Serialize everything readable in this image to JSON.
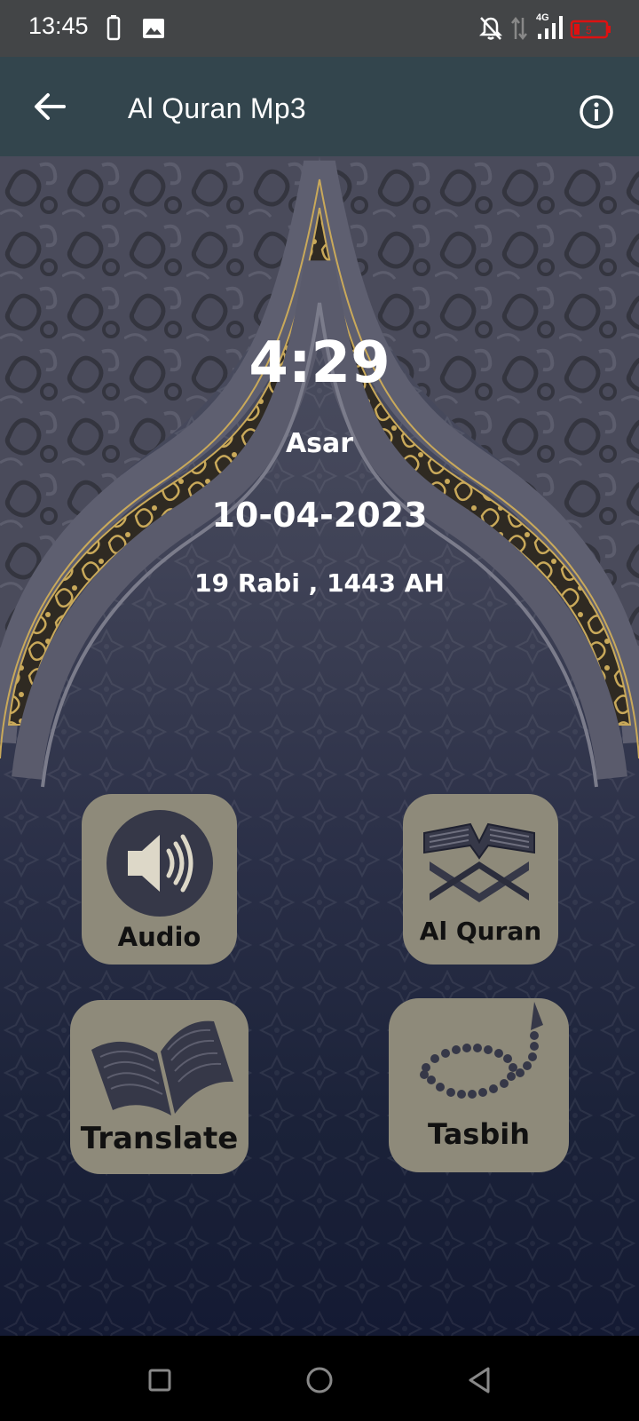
{
  "status_bar": {
    "time": "13:45",
    "network": "4G",
    "icons": [
      "battery-small-icon",
      "image-icon",
      "notification-off-icon",
      "data-arrows-icon",
      "signal-icon",
      "battery-icon"
    ]
  },
  "app_bar": {
    "title": "Al Quran Mp3",
    "back_icon": "arrow-left-icon",
    "info_icon": "info-icon"
  },
  "prayer": {
    "time": "4:29",
    "name": "Asar",
    "gregorian_date": "10-04-2023",
    "hijri_date": "19 Rabi , 1443 AH"
  },
  "menu": [
    {
      "label": "Audio",
      "icon": "speaker-icon"
    },
    {
      "label": "Al Quran",
      "icon": "quran-stand-icon"
    },
    {
      "label": "Translate",
      "icon": "open-book-icon"
    },
    {
      "label": "Tasbih",
      "icon": "prayer-beads-icon"
    }
  ],
  "colors": {
    "status_bar": "#434547",
    "app_bar": "#33454d",
    "tile": "#8e8a7a",
    "gold_accent": "#c9a95a"
  },
  "nav_bar": {
    "icons": [
      "recents-square-icon",
      "home-circle-icon",
      "back-triangle-icon"
    ]
  }
}
